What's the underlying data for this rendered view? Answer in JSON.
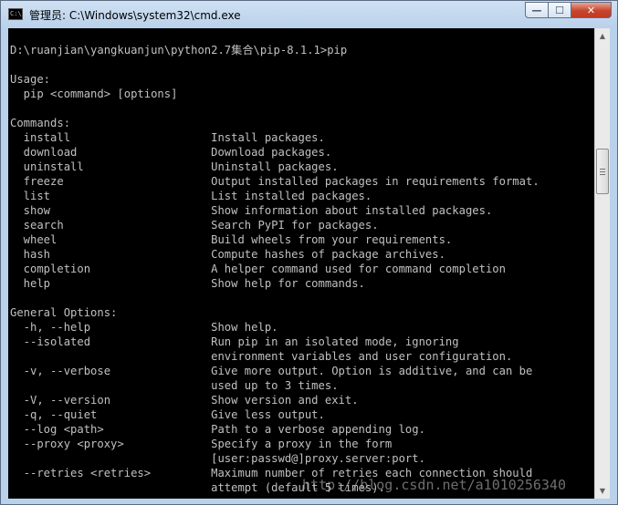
{
  "window": {
    "title": "管理员: C:\\Windows\\system32\\cmd.exe",
    "icon_label": "C:\\",
    "minimize_glyph": "—",
    "maximize_glyph": "☐",
    "close_glyph": "✕"
  },
  "console": {
    "lines": [
      "",
      "D:\\ruanjian\\yangkuanjun\\python2.7集合\\pip-8.1.1>pip",
      "",
      "Usage:",
      "  pip <command> [options]",
      "",
      "Commands:",
      "  install                     Install packages.",
      "  download                    Download packages.",
      "  uninstall                   Uninstall packages.",
      "  freeze                      Output installed packages in requirements format.",
      "  list                        List installed packages.",
      "  show                        Show information about installed packages.",
      "  search                      Search PyPI for packages.",
      "  wheel                       Build wheels from your requirements.",
      "  hash                        Compute hashes of package archives.",
      "  completion                  A helper command used for command completion",
      "  help                        Show help for commands.",
      "",
      "General Options:",
      "  -h, --help                  Show help.",
      "  --isolated                  Run pip in an isolated mode, ignoring",
      "                              environment variables and user configuration.",
      "  -v, --verbose               Give more output. Option is additive, and can be",
      "                              used up to 3 times.",
      "  -V, --version               Show version and exit.",
      "  -q, --quiet                 Give less output.",
      "  --log <path>                Path to a verbose appending log.",
      "  --proxy <proxy>             Specify a proxy in the form",
      "                              [user:passwd@]proxy.server:port.",
      "  --retries <retries>         Maximum number of retries each connection should",
      "                              attempt (default 5 times)."
    ]
  },
  "scrollbar": {
    "up_glyph": "▲",
    "down_glyph": "▼"
  },
  "watermark": "http://blog.csdn.net/a1010256340"
}
